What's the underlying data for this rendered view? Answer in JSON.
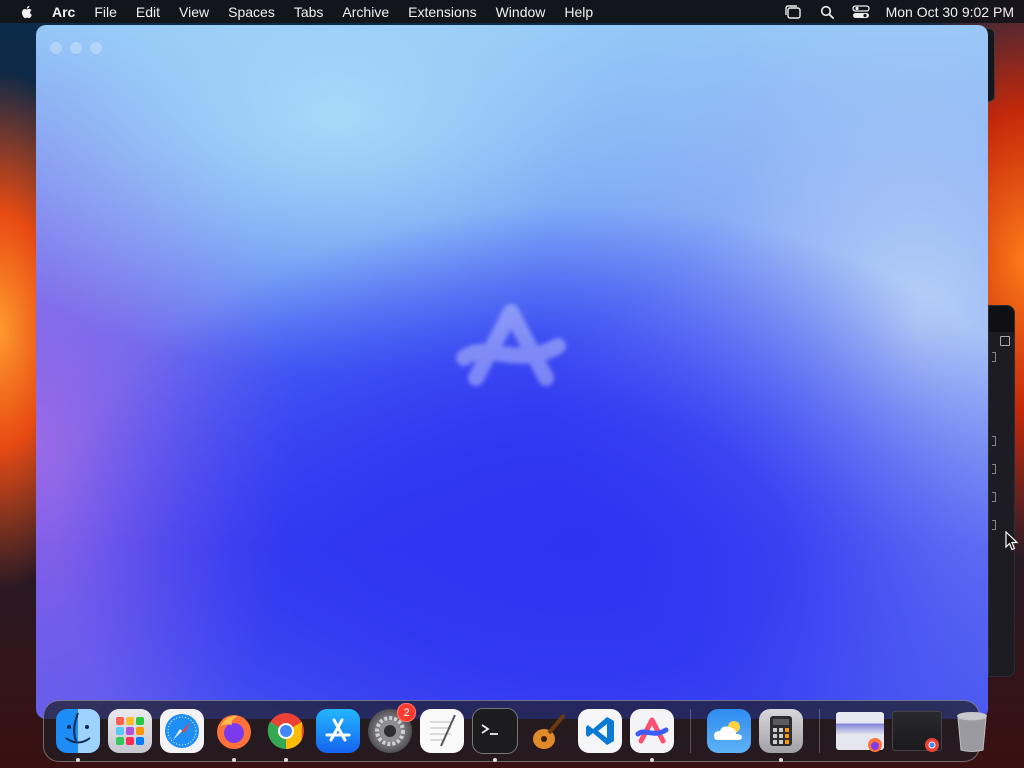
{
  "menubar": {
    "app_name": "Arc",
    "items": [
      "File",
      "Edit",
      "View",
      "Spaces",
      "Tabs",
      "Archive",
      "Extensions",
      "Window",
      "Help"
    ],
    "clock": "Mon Oct 30  9:02 PM",
    "status_icons": [
      "stage-manager-icon",
      "spotlight-search-icon",
      "control-center-icon"
    ]
  },
  "window": {
    "app": "Arc",
    "traffic_lights": [
      "close",
      "minimize",
      "zoom"
    ],
    "center_icon": "arc-logo-icon"
  },
  "dock": {
    "apps": [
      {
        "name": "Finder",
        "icon": "finder-icon",
        "running": true
      },
      {
        "name": "Launchpad",
        "icon": "launchpad-icon",
        "running": false
      },
      {
        "name": "Safari",
        "icon": "safari-icon",
        "running": false
      },
      {
        "name": "Firefox",
        "icon": "firefox-icon",
        "running": true
      },
      {
        "name": "Google Chrome",
        "icon": "chrome-icon",
        "running": true
      },
      {
        "name": "App Store",
        "icon": "app-store-icon",
        "running": false
      },
      {
        "name": "System Settings",
        "icon": "system-settings-icon",
        "running": false,
        "badge": "2"
      },
      {
        "name": "TextEdit",
        "icon": "textedit-icon",
        "running": false
      },
      {
        "name": "Terminal",
        "icon": "terminal-icon",
        "running": true
      },
      {
        "name": "GarageBand",
        "icon": "garageband-icon",
        "running": false
      },
      {
        "name": "Visual Studio Code",
        "icon": "vscode-icon",
        "running": false
      },
      {
        "name": "Arc",
        "icon": "arc-icon",
        "running": true
      }
    ],
    "recent_apps": [
      {
        "name": "Weather",
        "icon": "weather-icon",
        "running": false
      },
      {
        "name": "Calculator",
        "icon": "calculator-icon",
        "running": true
      }
    ],
    "minimized": [
      {
        "name": "Firefox window",
        "icon": "firefox-window-thumbnail"
      },
      {
        "name": "Chrome window",
        "icon": "chrome-window-thumbnail"
      }
    ],
    "trash": {
      "name": "Trash",
      "icon": "trash-icon"
    }
  },
  "colors": {
    "accent_blue": "#2e33f2",
    "menubar_bg": "#141419",
    "badge_red": "#ff3b30"
  }
}
